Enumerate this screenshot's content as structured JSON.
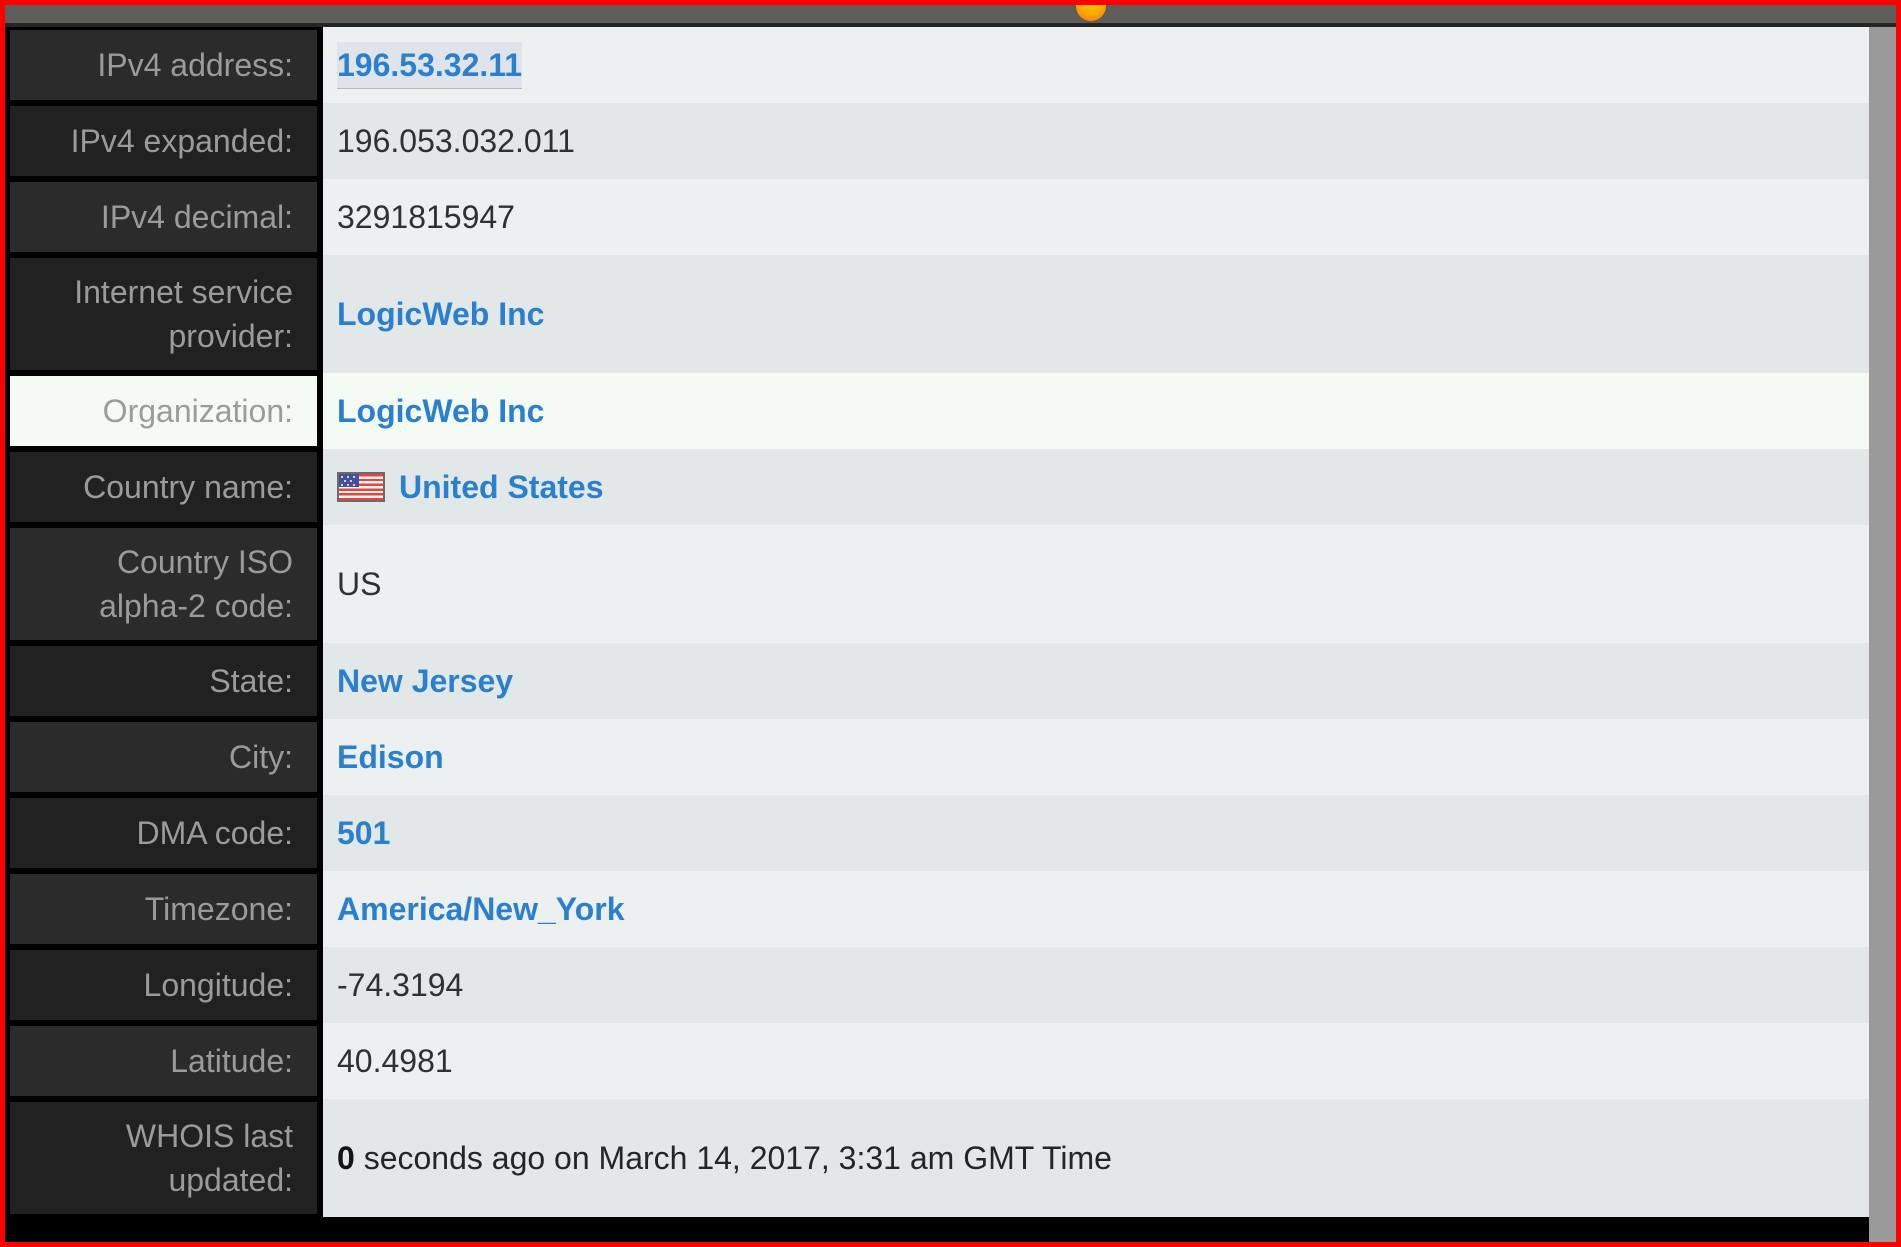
{
  "browser": {
    "logo_icon": "browser-logo-icon"
  },
  "scrollbar": {
    "orientation": "vertical"
  },
  "table": {
    "rows": [
      {
        "label": "IPv4 address:",
        "value": "196.53.32.11",
        "style": "link",
        "selected_text": true,
        "row_shade": "light",
        "label_shade": "dark",
        "row_selected": false
      },
      {
        "label": "IPv4 expanded:",
        "value": "196.053.032.011",
        "style": "plain",
        "selected_text": false,
        "row_shade": "dark",
        "label_shade": "darker",
        "row_selected": false
      },
      {
        "label": "IPv4 decimal:",
        "value": "3291815947",
        "style": "plain",
        "selected_text": false,
        "row_shade": "light",
        "label_shade": "dark",
        "row_selected": false
      },
      {
        "label": "Internet service provider:",
        "value": "LogicWeb Inc",
        "style": "link",
        "selected_text": false,
        "row_shade": "dark",
        "label_shade": "darker",
        "row_selected": false
      },
      {
        "label": "Organization:",
        "value": "LogicWeb Inc",
        "style": "link",
        "selected_text": false,
        "row_shade": "selected",
        "label_shade": "selected",
        "row_selected": true
      },
      {
        "label": "Country name:",
        "value": "United States",
        "style": "link",
        "icon": "us-flag-icon",
        "selected_text": false,
        "row_shade": "dark",
        "label_shade": "darker",
        "row_selected": false
      },
      {
        "label": "Country ISO alpha-2 code:",
        "value": "US",
        "style": "plain",
        "selected_text": false,
        "row_shade": "light",
        "label_shade": "dark",
        "row_selected": false
      },
      {
        "label": "State:",
        "value": "New Jersey",
        "style": "link",
        "selected_text": false,
        "row_shade": "dark",
        "label_shade": "darker",
        "row_selected": false
      },
      {
        "label": "City:",
        "value": "Edison",
        "style": "link",
        "selected_text": false,
        "row_shade": "light",
        "label_shade": "dark",
        "row_selected": false
      },
      {
        "label": "DMA code:",
        "value": "501",
        "style": "link",
        "selected_text": false,
        "row_shade": "dark",
        "label_shade": "darker",
        "row_selected": false
      },
      {
        "label": "Timezone:",
        "value": "America/New_York",
        "style": "link",
        "selected_text": false,
        "row_shade": "light",
        "label_shade": "dark",
        "row_selected": false
      },
      {
        "label": "Longitude:",
        "value": "-74.3194",
        "style": "plain",
        "selected_text": false,
        "row_shade": "dark",
        "label_shade": "darker",
        "row_selected": false
      },
      {
        "label": "Latitude:",
        "value": "40.4981",
        "style": "plain",
        "selected_text": false,
        "row_shade": "light",
        "label_shade": "dark",
        "row_selected": false
      },
      {
        "label": "WHOIS last updated:",
        "value_bold": "0",
        "value_rest": " seconds ago on March 14, 2017, 3:31 am GMT Time",
        "style": "semi",
        "selected_text": false,
        "row_shade": "dark",
        "label_shade": "darker",
        "row_selected": false
      }
    ]
  },
  "colors": {
    "frame_red": "#ff0000",
    "chrome_gray": "#5d5d5a",
    "link_blue": "#2a80ce",
    "label_bg_dark": "#2b2b2b",
    "label_bg_darker": "#212121",
    "label_text": "#9b9b9b",
    "row_light": "#ecf0f1",
    "row_dark": "#e1e8e7",
    "row_selected": "#f4fbf5",
    "scrollbar_gray": "#9a9a9a"
  }
}
